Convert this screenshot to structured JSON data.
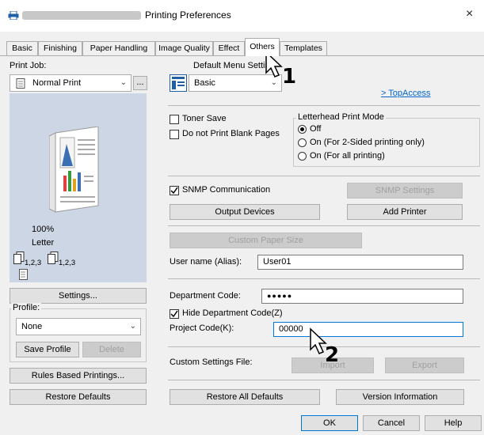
{
  "window": {
    "title": "Printing Preferences",
    "close_glyph": "×"
  },
  "tabs": [
    {
      "label": "Basic"
    },
    {
      "label": "Finishing"
    },
    {
      "label": "Paper Handling"
    },
    {
      "label": "Image Quality"
    },
    {
      "label": "Effect"
    },
    {
      "label": "Others"
    },
    {
      "label": "Templates"
    }
  ],
  "left": {
    "print_job_label": "Print Job:",
    "print_job_value": "Normal Print",
    "more_btn": "...",
    "zoom": "100%",
    "paper": "Letter",
    "order_1": "1,2,3",
    "order_2": "1,2,3",
    "settings_btn": "Settings...",
    "profile_label": "Profile:",
    "profile_value": "None",
    "save_profile_btn": "Save Profile",
    "delete_btn": "Delete",
    "rules_btn": "Rules Based Printings...",
    "restore_defaults_btn": "Restore Defaults"
  },
  "main": {
    "default_menu_label": "Default Menu Setting",
    "default_menu_value": "Basic",
    "topaccess_link": "> TopAccess",
    "toner_save": "Toner Save",
    "no_blank_pages": "Do not Print Blank Pages",
    "letterhead_title": "Letterhead Print Mode",
    "lh_off": "Off",
    "lh_2sided": "On (For 2-Sided printing only)",
    "lh_all": "On (For all printing)",
    "snmp_comm": "SNMP Communication",
    "snmp_settings_btn": "SNMP Settings",
    "output_devices_btn": "Output Devices",
    "add_printer_btn": "Add Printer",
    "custom_paper_btn": "Custom Paper Size",
    "user_name_label": "User name (Alias):",
    "user_name_value": "User01",
    "dept_code_label": "Department Code:",
    "dept_code_value": "●●●●●",
    "hide_dept_code": "Hide Department Code(Z)",
    "project_code_label": "Project Code(K):",
    "project_code_value": "00000",
    "custom_settings_label": "Custom Settings File:",
    "import_btn": "Import",
    "export_btn": "Export",
    "restore_all_btn": "Restore All Defaults",
    "version_btn": "Version Information"
  },
  "footer": {
    "ok": "OK",
    "cancel": "Cancel",
    "help": "Help"
  },
  "callouts": {
    "one": "1",
    "two": "2"
  }
}
